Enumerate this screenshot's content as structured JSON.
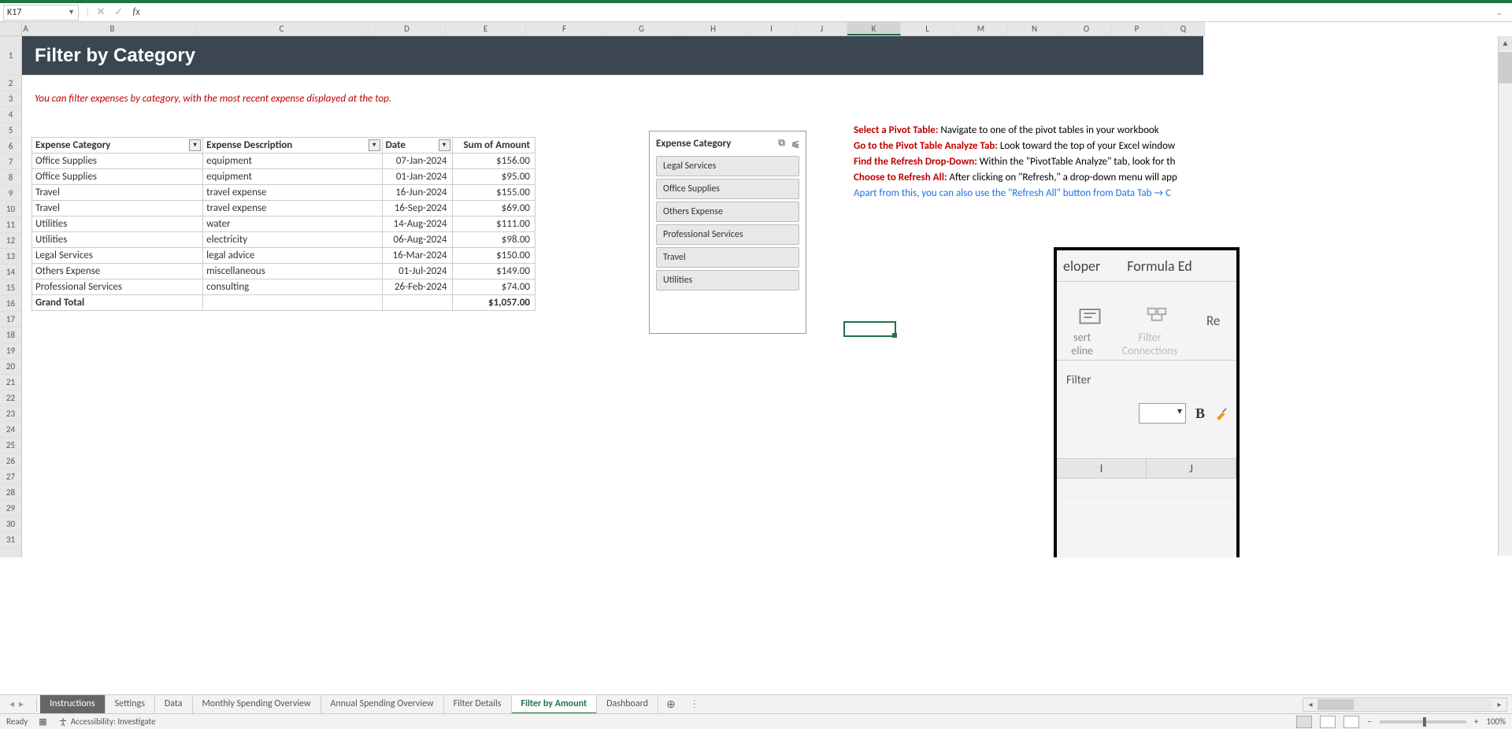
{
  "name_box": "K17",
  "title": "Filter by Category",
  "info_text": "You can filter expenses by category, with the most recent expense displayed at the top.",
  "col_labels": [
    "A",
    "B",
    "C",
    "D",
    "E",
    "F",
    "G",
    "H",
    "I",
    "J",
    "K",
    "L",
    "M",
    "N",
    "O",
    "P",
    "Q"
  ],
  "selected_col": "K",
  "row_labels": [
    "1",
    "2",
    "3",
    "4",
    "5",
    "6",
    "7",
    "8",
    "9",
    "10",
    "11",
    "12",
    "13",
    "14",
    "15",
    "16",
    "17",
    "18",
    "19",
    "20",
    "21",
    "22",
    "23",
    "24",
    "25",
    "26",
    "27",
    "28",
    "29",
    "30",
    "31"
  ],
  "pivot": {
    "headers": [
      "Expense Category",
      "Expense Description",
      "Date",
      "Sum of Amount"
    ],
    "rows": [
      [
        "Office Supplies",
        "equipment",
        "07-Jan-2024",
        "$156.00"
      ],
      [
        "Office Supplies",
        "equipment",
        "01-Jan-2024",
        "$95.00"
      ],
      [
        "Travel",
        "travel expense",
        "16-Jun-2024",
        "$155.00"
      ],
      [
        "Travel",
        "travel expense",
        "16-Sep-2024",
        "$69.00"
      ],
      [
        "Utilities",
        "water",
        "14-Aug-2024",
        "$111.00"
      ],
      [
        "Utilities",
        "electricity",
        "06-Aug-2024",
        "$98.00"
      ],
      [
        "Legal Services",
        "legal advice",
        "16-Mar-2024",
        "$150.00"
      ],
      [
        "Others Expense",
        "miscellaneous",
        "01-Jul-2024",
        "$149.00"
      ],
      [
        "Professional Services",
        "consulting",
        "26-Feb-2024",
        "$74.00"
      ]
    ],
    "total_label": "Grand Total",
    "total_value": "$1,057.00"
  },
  "slicer": {
    "title": "Expense Category",
    "items": [
      "Legal Services",
      "Office Supplies",
      "Others Expense",
      "Professional Services",
      "Travel",
      "Utilities"
    ]
  },
  "instructions": [
    {
      "bold": "Select a Pivot Table:",
      "rest": " Navigate to one of the pivot tables in your workbook"
    },
    {
      "bold": "Go to the Pivot Table Analyze Tab:",
      "rest": " Look toward the top of your Excel window"
    },
    {
      "bold": "Find the Refresh Drop-Down:",
      "rest": " Within the \"PivotTable Analyze\" tab, look for th"
    },
    {
      "bold": "Choose to Refresh All:",
      "rest": " After clicking on \"Refresh,\" a drop-down menu will app"
    }
  ],
  "instr_blue": "Apart from this, you can also use the \"Refresh All\" button from Data Tab → C",
  "float_img": {
    "tab1": "eloper",
    "tab2": "Formula Ed",
    "icon1_a": "sert",
    "icon1_b": "eline",
    "icon2_a": "Filter",
    "icon2_b": "Connections",
    "re": "Re",
    "filter": "Filter",
    "bold": "B",
    "mg_I": "I",
    "mg_J": "J"
  },
  "tabs": [
    {
      "label": "Instructions",
      "style": "dark"
    },
    {
      "label": "Settings",
      "style": ""
    },
    {
      "label": "Data",
      "style": ""
    },
    {
      "label": "Monthly Spending Overview",
      "style": ""
    },
    {
      "label": "Annual Spending Overview",
      "style": ""
    },
    {
      "label": "Filter Details",
      "style": ""
    },
    {
      "label": "Filter by Amount",
      "style": "active"
    },
    {
      "label": "Dashboard",
      "style": ""
    }
  ],
  "status": {
    "ready": "Ready",
    "accessibility": "Accessibility: Investigate",
    "zoom": "100%"
  }
}
